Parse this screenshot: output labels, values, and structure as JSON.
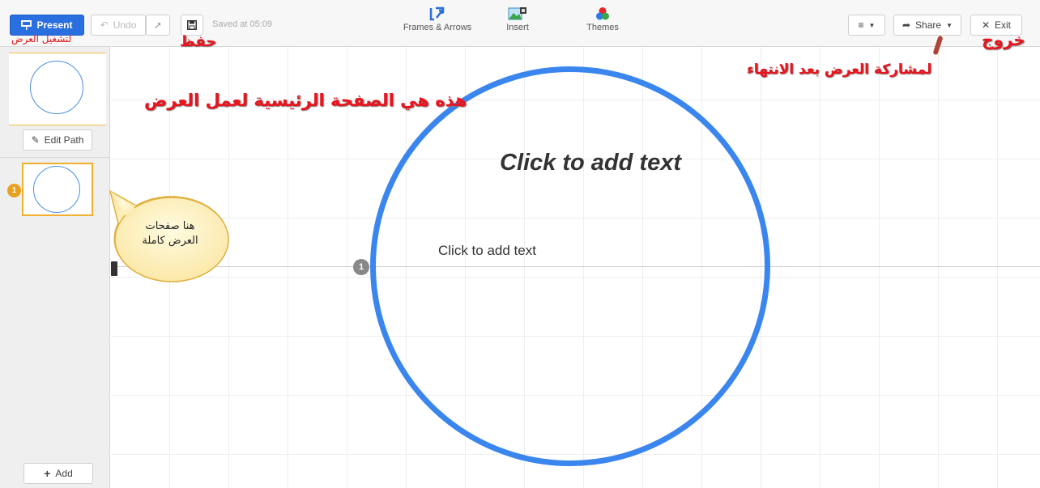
{
  "toolbar": {
    "present_label": "Present",
    "undo_label": "Undo",
    "saved_status": "Saved at 05:09",
    "tools": {
      "frames_label": "Frames & Arrows",
      "insert_label": "Insert",
      "themes_label": "Themes"
    },
    "share_label": "Share",
    "exit_label": "Exit"
  },
  "sidebar": {
    "edit_path_label": "Edit Path",
    "slide_number": "1",
    "add_label": "Add"
  },
  "canvas": {
    "title_placeholder": "Click to add text",
    "body_placeholder": "Click to add text",
    "path_number": "1"
  },
  "annotations": {
    "present": "لتشغيل العرض",
    "save": "حفظ",
    "main_page": "هذه هي الصفحة الرئيسية لعمل العرض",
    "share": "لمشاركة العرض بعد الانتهاء",
    "exit": "خروج",
    "callout_line1": "هنا صفحات",
    "callout_line2": "العرض كاملة"
  },
  "colors": {
    "accent": "#2a6fe0",
    "circle": "#3a86ee",
    "annotation": "#e8141e",
    "slide_highlight": "#f0b030"
  },
  "icons": [
    "presentation-icon",
    "undo-icon",
    "redo-icon",
    "save-icon",
    "frames-arrows-icon",
    "insert-image-icon",
    "themes-icon",
    "hamburger-menu-icon",
    "share-icon",
    "close-icon",
    "pencil-icon",
    "plus-icon"
  ]
}
